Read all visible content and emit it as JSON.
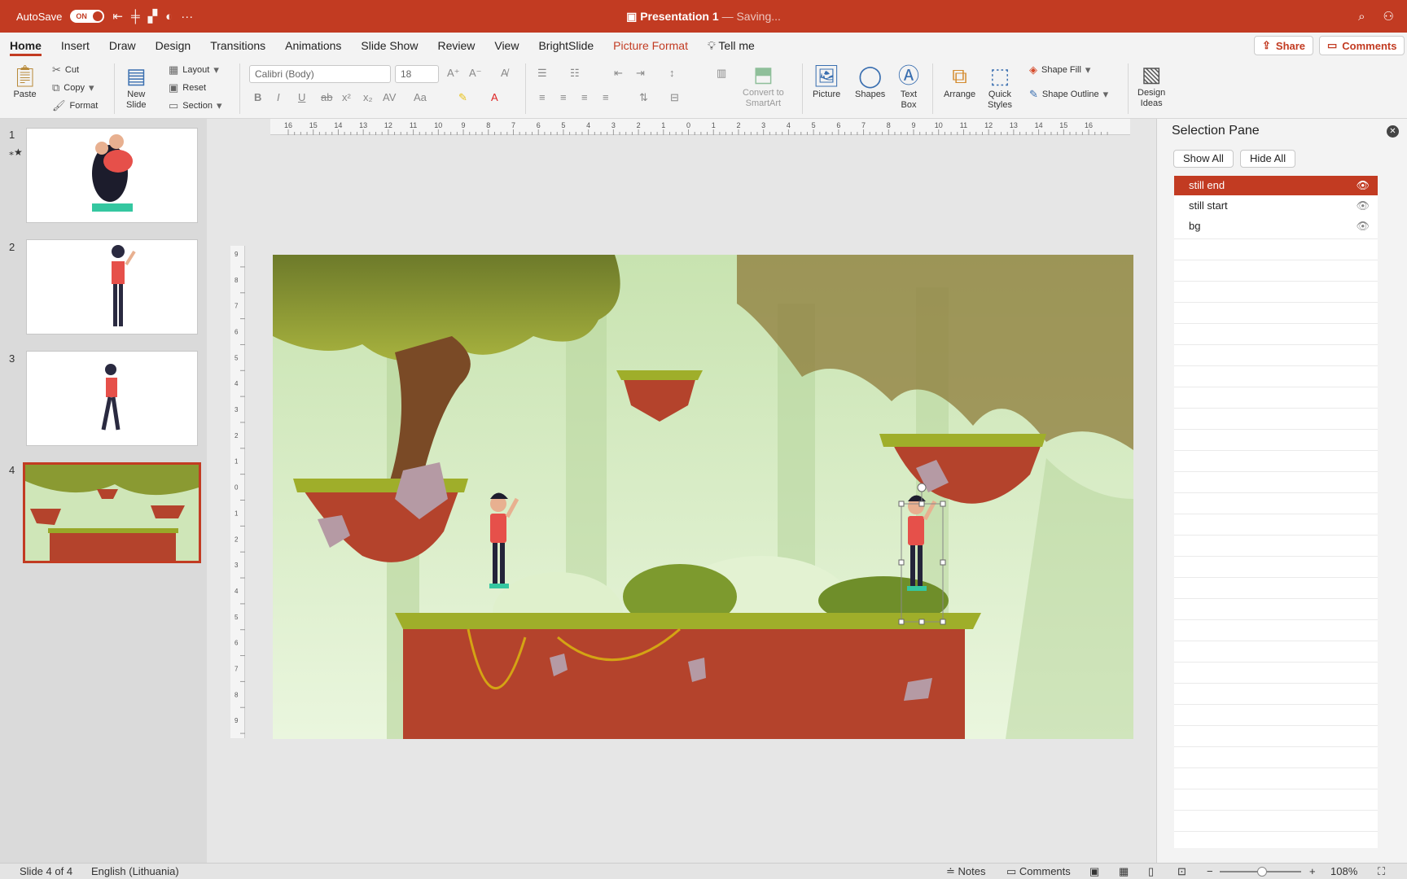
{
  "titlebar": {
    "autosave_label": "AutoSave",
    "autosave_state": "ON",
    "title": "Presentation 1",
    "status": "— Saving..."
  },
  "menu": {
    "tabs": [
      "Home",
      "Insert",
      "Draw",
      "Design",
      "Transitions",
      "Animations",
      "Slide Show",
      "Review",
      "View",
      "BrightSlide",
      "Picture Format"
    ],
    "tell_me": "Tell me",
    "share": "Share",
    "comments": "Comments"
  },
  "ribbon": {
    "paste": "Paste",
    "cut": "Cut",
    "copy": "Copy",
    "format": "Format",
    "new_slide_1": "New",
    "new_slide_2": "Slide",
    "layout": "Layout",
    "reset": "Reset",
    "section": "Section",
    "font_name": "Calibri (Body)",
    "font_size": "18",
    "convert_1": "Convert to",
    "convert_2": "SmartArt",
    "picture": "Picture",
    "shapes": "Shapes",
    "text_box_1": "Text",
    "text_box_2": "Box",
    "arrange": "Arrange",
    "quick_styles_1": "Quick",
    "quick_styles_2": "Styles",
    "shape_fill": "Shape Fill",
    "shape_outline": "Shape Outline",
    "design_ideas_1": "Design",
    "design_ideas_2": "Ideas"
  },
  "slides": {
    "numbers": [
      "1",
      "2",
      "3",
      "4"
    ],
    "selected": 4
  },
  "ruler": {
    "h_ticks": [
      "16",
      "15",
      "14",
      "13",
      "12",
      "11",
      "10",
      "9",
      "8",
      "7",
      "6",
      "5",
      "4",
      "3",
      "2",
      "1",
      "0",
      "1",
      "2",
      "3",
      "4",
      "5",
      "6",
      "7",
      "8",
      "9",
      "10",
      "11",
      "12",
      "13",
      "14",
      "15",
      "16"
    ],
    "v_ticks": [
      "9",
      "8",
      "7",
      "6",
      "5",
      "4",
      "3",
      "2",
      "1",
      "0",
      "1",
      "2",
      "3",
      "4",
      "5",
      "6",
      "7",
      "8",
      "9"
    ]
  },
  "selection_pane": {
    "title": "Selection Pane",
    "show_all": "Show All",
    "hide_all": "Hide All",
    "items": [
      {
        "label": "still end",
        "selected": true
      },
      {
        "label": "still start",
        "selected": false
      },
      {
        "label": "bg",
        "selected": false
      }
    ]
  },
  "statusbar": {
    "slide_info": "Slide 4 of 4",
    "language": "English (Lithuania)",
    "notes": "Notes",
    "comments": "Comments",
    "zoom": "108%"
  },
  "colors": {
    "accent": "#c23b22",
    "forest_light": "#d8ecc4",
    "ground": "#b4432c",
    "grass": "#8ea22a"
  }
}
